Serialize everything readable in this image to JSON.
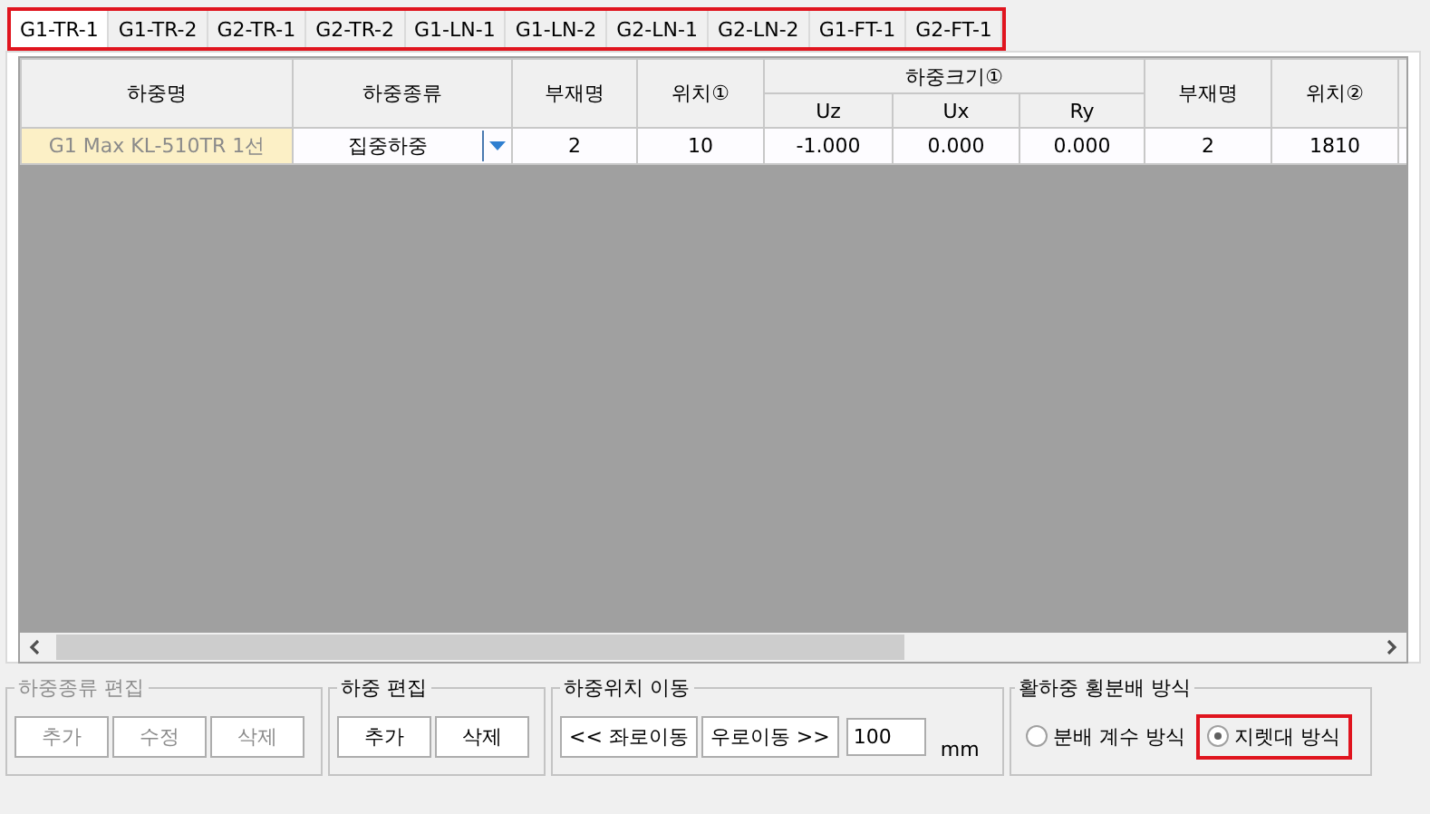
{
  "tab_strip": {
    "highlighted": true,
    "tabs": [
      {
        "label": "G1-TR-1",
        "selected": true
      },
      {
        "label": "G1-TR-2",
        "selected": false
      },
      {
        "label": "G2-TR-1",
        "selected": false
      },
      {
        "label": "G2-TR-2",
        "selected": false
      },
      {
        "label": "G1-LN-1",
        "selected": false
      },
      {
        "label": "G1-LN-2",
        "selected": false
      },
      {
        "label": "G2-LN-1",
        "selected": false
      },
      {
        "label": "G2-LN-2",
        "selected": false
      },
      {
        "label": "G1-FT-1",
        "selected": false
      },
      {
        "label": "G2-FT-1",
        "selected": false
      }
    ]
  },
  "table": {
    "column_group": {
      "label": "하중크기①"
    },
    "columns": [
      {
        "label": "하중명",
        "kind": "main"
      },
      {
        "label": "하중종류",
        "kind": "main"
      },
      {
        "label": "부재명",
        "kind": "main"
      },
      {
        "label": "위치①",
        "kind": "main"
      },
      {
        "label": "Uz",
        "kind": "sub"
      },
      {
        "label": "Ux",
        "kind": "sub"
      },
      {
        "label": "Ry",
        "kind": "sub"
      },
      {
        "label": "부재명",
        "kind": "main"
      },
      {
        "label": "위치②",
        "kind": "main"
      }
    ],
    "rows": [
      {
        "cells": [
          {
            "kind": "name",
            "text": "G1 Max KL-510TR 1선"
          },
          {
            "kind": "combo",
            "text": "집중하중"
          },
          {
            "kind": "text",
            "text": "2"
          },
          {
            "kind": "text",
            "text": "10"
          },
          {
            "kind": "text",
            "text": "-1.000"
          },
          {
            "kind": "text",
            "text": "0.000"
          },
          {
            "kind": "text",
            "text": "0.000"
          },
          {
            "kind": "text",
            "text": "2"
          },
          {
            "kind": "text",
            "text": "1810"
          }
        ]
      }
    ]
  },
  "groups": [
    {
      "kind": "buttons",
      "title": "하중종류 편집",
      "disabled": true,
      "buttons": [
        "추가",
        "수정",
        "삭제"
      ]
    },
    {
      "kind": "buttons",
      "title": "하중 편집",
      "disabled": false,
      "buttons": [
        "추가",
        "삭제"
      ]
    },
    {
      "kind": "move",
      "title": "하중위치 이동",
      "disabled": false,
      "buttons": [
        "<< 좌로이동",
        "우로이동 >>"
      ],
      "value": "100",
      "unit": "mm"
    },
    {
      "kind": "radios",
      "title": "활하중 횡분배 방식",
      "disabled": false,
      "options": [
        {
          "label": "분배 계수 방식",
          "selected": false,
          "highlighted": false
        },
        {
          "label": "지렛대 방식",
          "selected": true,
          "highlighted": true
        }
      ]
    }
  ]
}
